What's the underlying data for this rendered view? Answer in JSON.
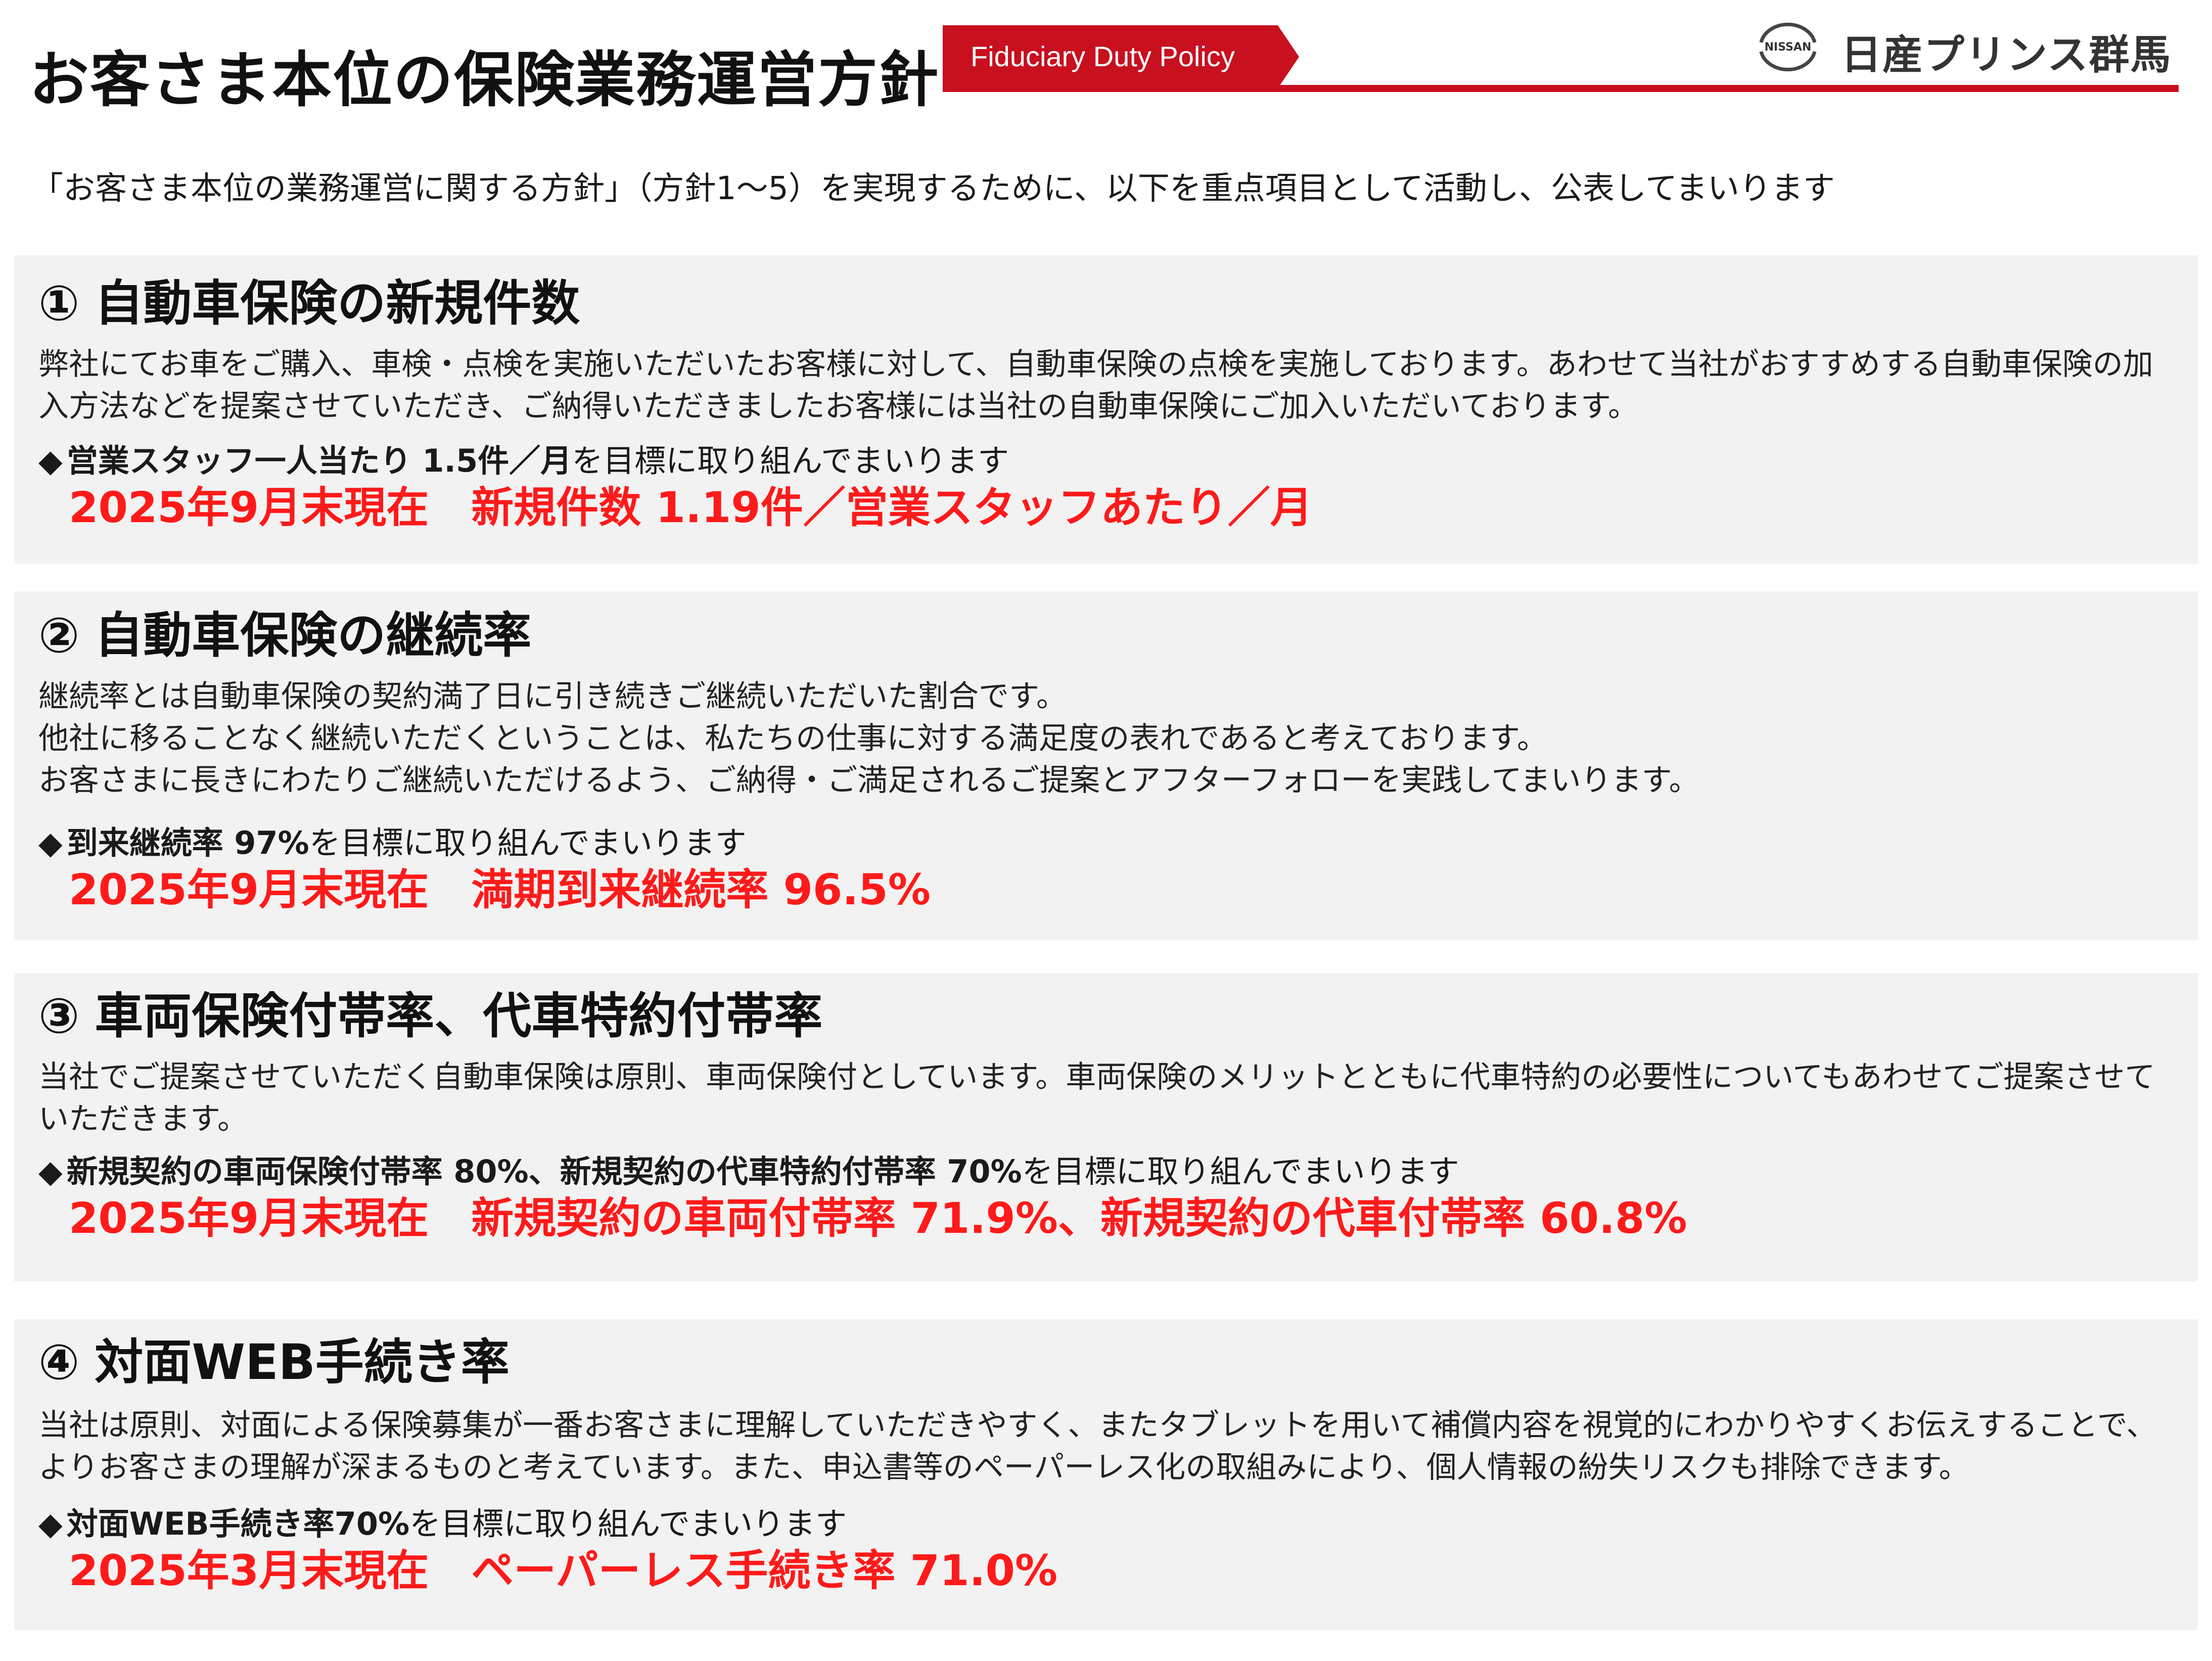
{
  "header": {
    "title": "お客さま本位の保険業務運営方針",
    "subtitle": "Fiduciary Duty Policy",
    "logo_emblem_text": "NISSAN",
    "logo_text": "日産プリンス群馬",
    "colors": {
      "accent": "#c8101f",
      "result_red": "#ff1a1a",
      "panel_bg": "#f2f2f2"
    }
  },
  "intro": "「お客さま本位の業務運営に関する方針」（方針1～5）を実現するために、以下を重点項目として活動し、公表してまいります",
  "sections": [
    {
      "number": "①",
      "title": "自動車保険の新規件数",
      "body": [
        "弊社にてお車をご購入、車検・点検を実施いただいたお客様に対して、自動車保険の点検を実施しております。あわせて当社がおすすめする自動車保険の加入方法などを提案させていただき、ご納得いただきましたお客様には当社の自動車保険にご加入いただいております。"
      ],
      "goal_bullet": "◆",
      "goal_bold": "営業スタッフ一人当たり 1.5件／月",
      "goal_rest": "を目標に取り組んでまいります",
      "result": "2025年9月末現在　新規件数 1.19件／営業スタッフあたり／月"
    },
    {
      "number": "②",
      "title": "自動車保険の継続率",
      "body": [
        "継続率とは自動車保険の契約満了日に引き続きご継続いただいた割合です。",
        "他社に移ることなく継続いただくということは、私たちの仕事に対する満足度の表れであると考えております。",
        "お客さまに長きにわたりご継続いただけるよう、ご納得・ご満足されるご提案とアフターフォローを実践してまいります。"
      ],
      "goal_bullet": "◆",
      "goal_bold": "到来継続率 97%",
      "goal_rest": "を目標に取り組んでまいります",
      "result": "2025年9月末現在　満期到来継続率 96.5%"
    },
    {
      "number": "③",
      "title": "車両保険付帯率、代車特約付帯率",
      "body": [
        "当社でご提案させていただく自動車保険は原則、車両保険付としています。車両保険のメリットとともに代車特約の必要性についてもあわせてご提案させていただきます。"
      ],
      "goal_bullet": "◆",
      "goal_bold": "新規契約の車両保険付帯率 80%、新規契約の代車特約付帯率 70%",
      "goal_rest": "を目標に取り組んでまいります",
      "result": "2025年9月末現在　新規契約の車両付帯率 71.9%、新規契約の代車付帯率 60.8%"
    },
    {
      "number": "④",
      "title": "対面WEB手続き率",
      "body": [
        "当社は原則、対面による保険募集が一番お客さまに理解していただきやすく、またタブレットを用いて補償内容を視覚的にわかりやすくお伝えすることで、よりお客さまの理解が深まるものと考えています。また、申込書等のペーパーレス化の取組みにより、個人情報の紛失リスクも排除できます。"
      ],
      "goal_bullet": "◆",
      "goal_bold": "対面WEB手続き率70%",
      "goal_rest": "を目標に取り組んでまいります",
      "result": "2025年3月末現在　ペーパーレス手続き率 71.0%"
    }
  ]
}
